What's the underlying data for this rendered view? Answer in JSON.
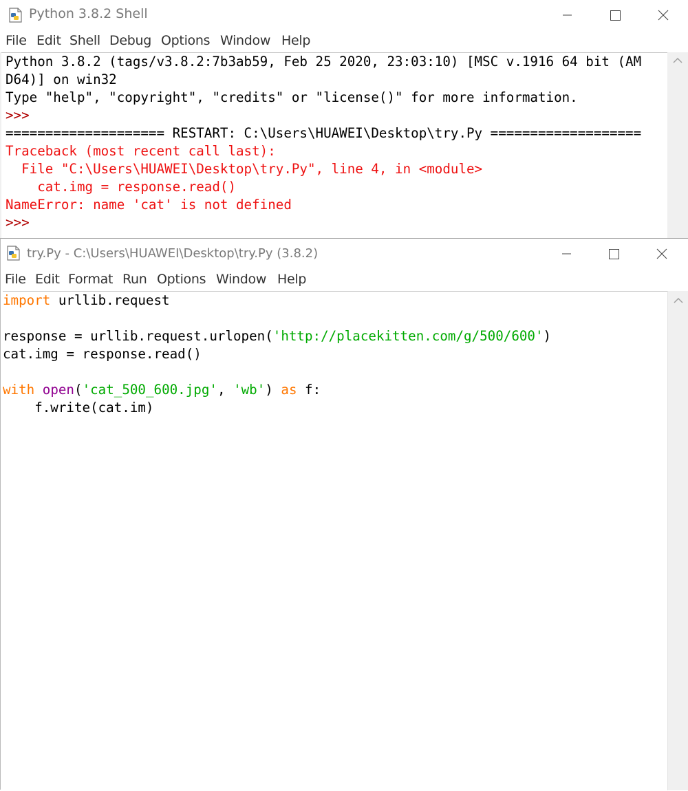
{
  "shell": {
    "title": "Python 3.8.2 Shell",
    "menu": [
      "File",
      "Edit",
      "Shell",
      "Debug",
      "Options",
      "Window",
      "Help"
    ],
    "lines": [
      {
        "cls": "",
        "text": "Python 3.8.2 (tags/v3.8.2:7b3ab59, Feb 25 2020, 23:03:10) [MSC v.1916 64 bit (AM"
      },
      {
        "cls": "",
        "text": "D64)] on win32"
      },
      {
        "cls": "",
        "text": "Type \"help\", \"copyright\", \"credits\" or \"license()\" for more information."
      },
      {
        "cls": "prompt",
        "text": ">>> "
      },
      {
        "cls": "",
        "text": "==================== RESTART: C:\\Users\\HUAWEI\\Desktop\\try.Py ==================="
      },
      {
        "cls": "red",
        "text": "Traceback (most recent call last):"
      },
      {
        "cls": "red",
        "text": "  File \"C:\\Users\\HUAWEI\\Desktop\\try.Py\", line 4, in <module>"
      },
      {
        "cls": "red",
        "text": "    cat.img = response.read()"
      },
      {
        "cls": "red",
        "text": "NameError: name 'cat' is not defined"
      },
      {
        "cls": "prompt",
        "text": ">>> "
      }
    ]
  },
  "editor": {
    "title": "try.Py - C:\\Users\\HUAWEI\\Desktop\\try.Py (3.8.2)",
    "menu": [
      "File",
      "Edit",
      "Format",
      "Run",
      "Options",
      "Window",
      "Help"
    ],
    "lines": [
      [
        {
          "t": "import",
          "c": "kw"
        },
        {
          "t": " urllib.request",
          "c": ""
        }
      ],
      [],
      [
        {
          "t": "response = urllib.request.urlopen(",
          "c": ""
        },
        {
          "t": "'http://placekitten.com/g/500/600'",
          "c": "str"
        },
        {
          "t": ")",
          "c": ""
        }
      ],
      [
        {
          "t": "cat.img = response.read()",
          "c": ""
        }
      ],
      [],
      [
        {
          "t": "with",
          "c": "kw"
        },
        {
          "t": " ",
          "c": ""
        },
        {
          "t": "open",
          "c": "bi"
        },
        {
          "t": "(",
          "c": ""
        },
        {
          "t": "'cat_500_600.jpg'",
          "c": "str"
        },
        {
          "t": ", ",
          "c": ""
        },
        {
          "t": "'wb'",
          "c": "str"
        },
        {
          "t": ") ",
          "c": ""
        },
        {
          "t": "as",
          "c": "kw"
        },
        {
          "t": " f:",
          "c": ""
        }
      ],
      [
        {
          "t": "    f.write(cat.im)",
          "c": ""
        }
      ]
    ]
  },
  "icons": {
    "window_icon": "python-idle-icon",
    "minimize": "minimize-icon",
    "maximize": "maximize-icon",
    "close": "close-icon",
    "scroll_up": "scroll-up-icon"
  }
}
